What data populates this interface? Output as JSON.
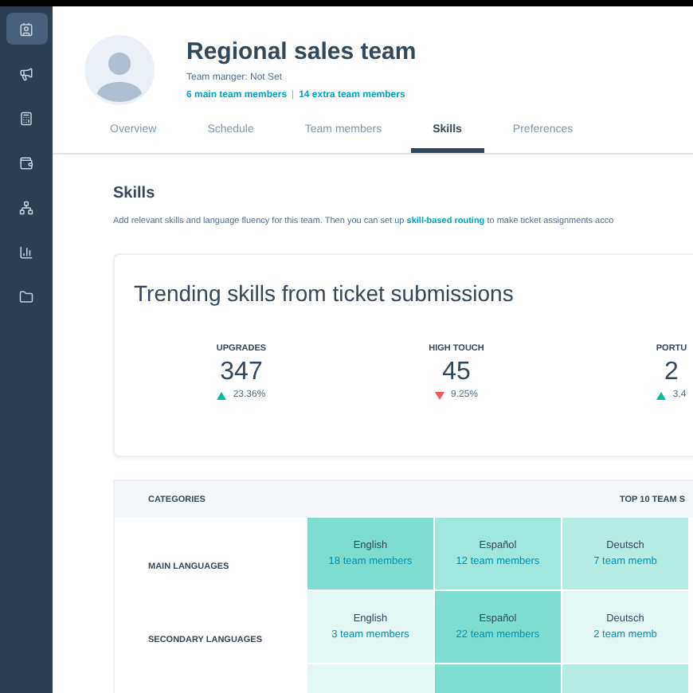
{
  "sidebar": {
    "items": [
      {
        "selected": true
      },
      {
        "selected": false
      },
      {
        "selected": false
      },
      {
        "selected": false
      },
      {
        "selected": false
      },
      {
        "selected": false
      },
      {
        "selected": false
      }
    ]
  },
  "header": {
    "title": "Regional sales team",
    "manager": "Team manger: Not Set",
    "main_members": "6 main team members",
    "separator": "|",
    "extra_members": "14 extra team members"
  },
  "tabs": [
    {
      "label": "Overview",
      "selected": false
    },
    {
      "label": "Schedule",
      "selected": false
    },
    {
      "label": "Team members",
      "selected": false
    },
    {
      "label": "Skills",
      "selected": true
    },
    {
      "label": "Preferences",
      "selected": false
    }
  ],
  "skills": {
    "heading": "Skills",
    "description": "Add relevant skills and language fluency for this team. Then you can set up **skill-based routing** to make ticket assignments acco"
  },
  "trending": {
    "title": "Trending skills from ticket submissions",
    "stats": [
      {
        "label": "UPGRADES",
        "value": "347",
        "change": "23.36%",
        "kind": "rise"
      },
      {
        "label": "HIGH TOUCH",
        "value": "45",
        "change": "9.25%",
        "kind": "fall"
      },
      {
        "label": "PORTU",
        "value": "2",
        "change": "3,4",
        "kind": "rise"
      }
    ]
  },
  "table": {
    "column_1": "CATEGORIES",
    "column_2": "TOP 10 TEAM S",
    "rows": [
      {
        "category": "MAIN LANGUAGES",
        "cells": [
          {
            "skill": "English",
            "members": "18 team members",
            "color": "#7fddd0"
          },
          {
            "skill": "Español",
            "members": "12 team members",
            "color": "#9fe6dc"
          },
          {
            "skill": "Deutsch",
            "members": "7 team memb",
            "color": "#b5ece4"
          }
        ]
      },
      {
        "category": "SECONDARY LANGUAGES",
        "cells": [
          {
            "skill": "English",
            "members": "3 team members",
            "color": "#e3f6f3"
          },
          {
            "skill": "Español",
            "members": "22 team members",
            "color": "#7fddd0"
          },
          {
            "skill": "Deutsch",
            "members": "2 team memb",
            "color": "#e3f6f3"
          }
        ]
      },
      {
        "cells": [
          {
            "color": "#e3f6f3"
          },
          {
            "color": "#7fddd0"
          },
          {
            "color": "#b5ece4"
          }
        ]
      }
    ]
  }
}
